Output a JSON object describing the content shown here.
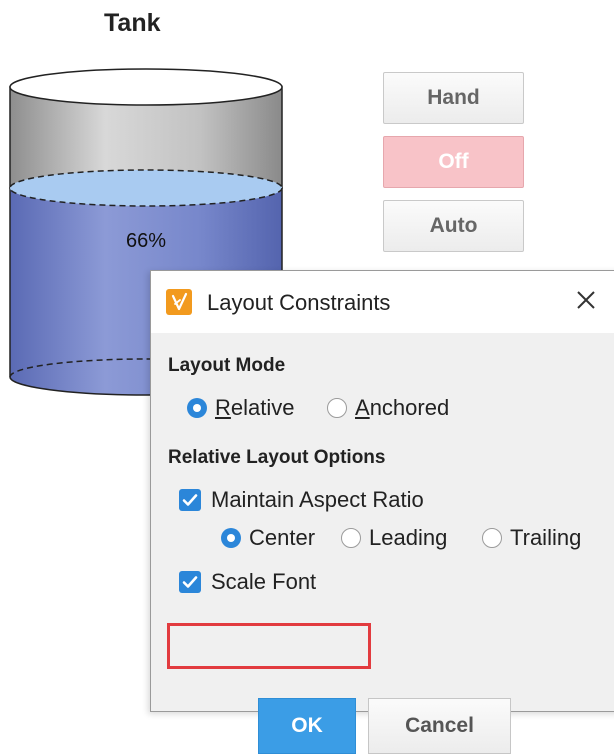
{
  "tank": {
    "title": "Tank",
    "level_text": "66%",
    "level_fraction": 0.66,
    "liquid_color": "#7383c8",
    "liquid_top_color": "#a9cbf1"
  },
  "mode_buttons": {
    "hand_label": "Hand",
    "off_label": "Off",
    "auto_label": "Auto",
    "active": "Off"
  },
  "dialog": {
    "title": "Layout Constraints",
    "icon": "wand-icon",
    "close_icon": "close-icon",
    "layout_mode": {
      "label": "Layout Mode",
      "relative_prefix": "R",
      "relative_rest": "elative",
      "anchored_prefix": "A",
      "anchored_rest": "nchored",
      "selected": "Relative"
    },
    "relative_options": {
      "label": "Relative Layout Options",
      "maintain_aspect_ratio": "Maintain Aspect Ratio",
      "maintain_checked": true,
      "alignment": {
        "center": "Center",
        "leading": "Leading",
        "trailing": "Trailing",
        "selected": "Center"
      },
      "scale_font": "Scale Font",
      "scale_font_checked": true
    },
    "buttons": {
      "ok": "OK",
      "cancel": "Cancel"
    },
    "highlight_color": "#e23b3f",
    "accent_color": "#2b86d9"
  }
}
